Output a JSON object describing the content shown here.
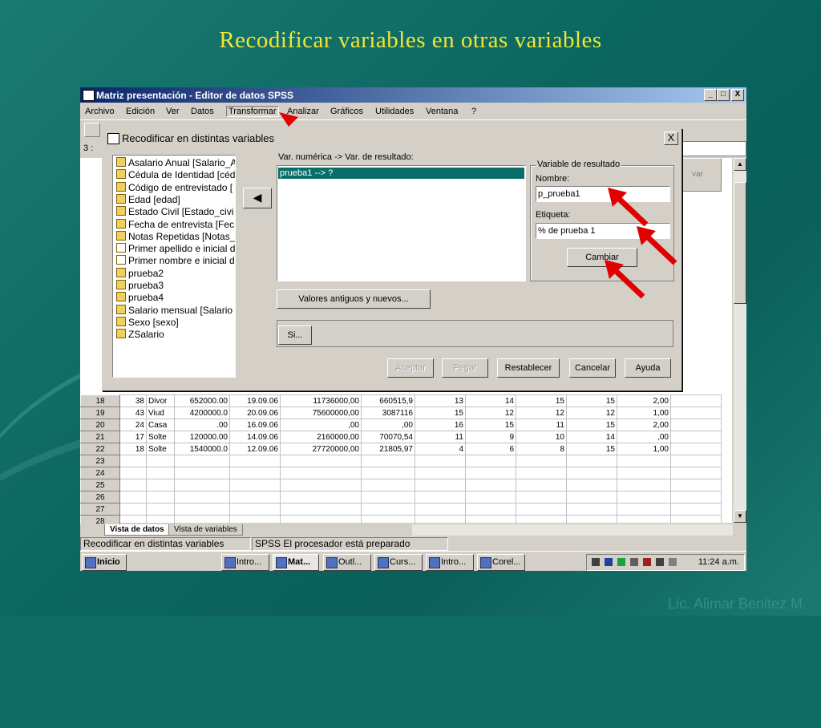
{
  "slide": {
    "title": "Recodificar variables en otras variables",
    "credit": "Lic. Alimar Benitez M."
  },
  "window": {
    "title": "Matriz presentación - Editor de datos SPSS",
    "min": "_",
    "max": "□",
    "close": "X"
  },
  "menu": [
    "Archivo",
    "Edición",
    "Ver",
    "Datos",
    "Transformar",
    "Analizar",
    "Gráficos",
    "Utilidades",
    "Ventana",
    "?"
  ],
  "cellref": "3 :",
  "grid": {
    "var_header": "var",
    "rows": [
      [
        "18",
        "38",
        "Divor",
        "652000.00",
        "19.09.06",
        "11736000,00",
        "660515,9",
        "13",
        "14",
        "15",
        "15",
        "2,00"
      ],
      [
        "19",
        "43",
        "Viud",
        "4200000.0",
        "20.09.06",
        "75600000,00",
        "3087116",
        "15",
        "12",
        "12",
        "12",
        "1,00"
      ],
      [
        "20",
        "24",
        "Casa",
        ".00",
        "16.09.06",
        ",00",
        ",00",
        "16",
        "15",
        "11",
        "15",
        "2,00"
      ],
      [
        "21",
        "17",
        "Solte",
        "120000.00",
        "14.09.06",
        "2160000,00",
        "70070,54",
        "11",
        "9",
        "10",
        "14",
        ",00"
      ],
      [
        "22",
        "18",
        "Solte",
        "1540000.0",
        "12.09.06",
        "27720000,00",
        "21805,97",
        "4",
        "6",
        "8",
        "15",
        "1,00"
      ],
      [
        "23",
        "",
        "",
        "",
        "",
        "",
        "",
        "",
        "",
        "",
        "",
        ""
      ],
      [
        "24",
        "",
        "",
        "",
        "",
        "",
        "",
        "",
        "",
        "",
        "",
        ""
      ],
      [
        "25",
        "",
        "",
        "",
        "",
        "",
        "",
        "",
        "",
        "",
        "",
        ""
      ],
      [
        "26",
        "",
        "",
        "",
        "",
        "",
        "",
        "",
        "",
        "",
        "",
        ""
      ],
      [
        "27",
        "",
        "",
        "",
        "",
        "",
        "",
        "",
        "",
        "",
        "",
        ""
      ],
      [
        "28",
        "",
        "",
        "",
        "",
        "",
        "",
        "",
        "",
        "",
        "",
        ""
      ]
    ]
  },
  "tabs": {
    "data_view": "Vista de datos",
    "var_view": "Vista de variables"
  },
  "status": {
    "left": "Recodificar en distintas variables",
    "right": "SPSS El procesador  está preparado"
  },
  "taskbar": {
    "start": "Inicio",
    "tasks": [
      "Intro...",
      "Mat...",
      "Outl...",
      "Curs...",
      "Intro...",
      "Corel..."
    ],
    "clock": "11:24 a.m."
  },
  "dialog": {
    "title": "Recodificar en distintas variables",
    "close": "X",
    "variables": [
      {
        "label": "Asalario Anual [Salario_A",
        "kind": "numeric"
      },
      {
        "label": "Cédula de Identidad [céd",
        "kind": "numeric"
      },
      {
        "label": "Código de entrevistado [",
        "kind": "numeric"
      },
      {
        "label": "Edad [edad]",
        "kind": "numeric"
      },
      {
        "label": "Estado Civil [Estado_civi",
        "kind": "numeric"
      },
      {
        "label": "Fecha de entrevista  [Fec",
        "kind": "numeric"
      },
      {
        "label": "Notas Repetidas [Notas_",
        "kind": "numeric"
      },
      {
        "label": "Primer apellido e inicial d",
        "kind": "string"
      },
      {
        "label": "Primer nombre e inicial d",
        "kind": "string"
      },
      {
        "label": "prueba2",
        "kind": "numeric"
      },
      {
        "label": "prueba3",
        "kind": "numeric"
      },
      {
        "label": "prueba4",
        "kind": "numeric"
      },
      {
        "label": "Salario mensual [Salario",
        "kind": "numeric"
      },
      {
        "label": "Sexo [sexo]",
        "kind": "numeric"
      },
      {
        "label": "ZSalario",
        "kind": "numeric"
      }
    ],
    "move_arrow": "◀",
    "map_label": "Var. numérica -> Var. de resultado:",
    "map_selected": "prueba1 --> ?",
    "group_title": "Variable de resultado",
    "name_label": "Nombre:",
    "name_value": "p_prueba1",
    "label_label": "Etiqueta:",
    "label_value": "% de prueba 1",
    "change_button": "Cambiar",
    "old_new_button": "Valores antiguos y nuevos...",
    "if_button": "Si...",
    "ok_button": "Aceptar",
    "paste_button": "Pegar",
    "reset_button": "Restablecer",
    "cancel_button": "Cancelar",
    "help_button": "Ayuda"
  },
  "colors": {
    "title_text": "#f2e634",
    "arrows": "#e00000",
    "selection": "#0a6e68"
  }
}
